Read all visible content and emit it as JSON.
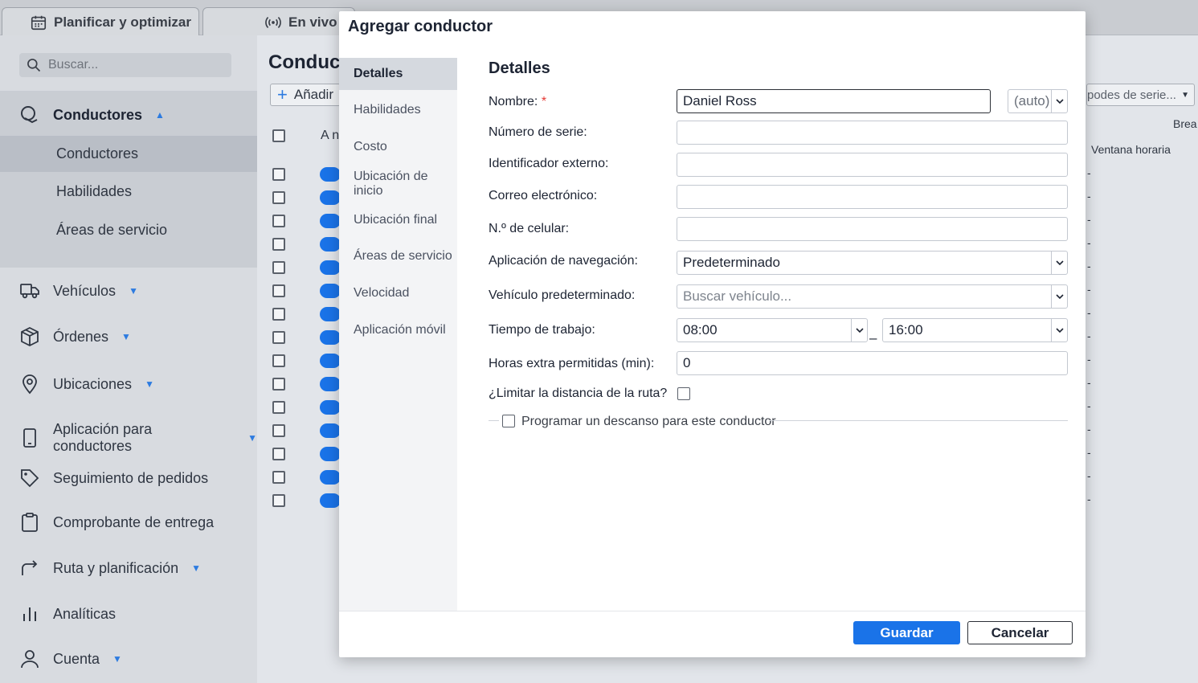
{
  "tabs": [
    {
      "label": "Planificar y optimizar",
      "icon": "calendar-icon"
    },
    {
      "label": "En vivo",
      "icon": "broadcast-icon"
    }
  ],
  "sidebar": {
    "search_placeholder": "Buscar...",
    "items": [
      {
        "label": "Conductores",
        "icon": "steering-wheel-icon",
        "expanded": true
      },
      {
        "label": "Vehículos",
        "icon": "truck-icon"
      },
      {
        "label": "Órdenes",
        "icon": "package-icon"
      },
      {
        "label": "Ubicaciones",
        "icon": "map-pin-icon"
      },
      {
        "label": "Aplicación para conductores",
        "icon": "phone-icon"
      },
      {
        "label": "Seguimiento de pedidos",
        "icon": "tag-icon"
      },
      {
        "label": "Comprobante de entrega",
        "icon": "clipboard-icon"
      },
      {
        "label": "Ruta y planificación",
        "icon": "route-arrow-icon"
      },
      {
        "label": "Analíticas",
        "icon": "bar-chart-icon"
      },
      {
        "label": "Cuenta",
        "icon": "user-icon"
      }
    ],
    "subitems": [
      "Conductores",
      "Habilidades",
      "Áreas de servicio"
    ],
    "active_subitem": "Conductores"
  },
  "background": {
    "title": "Conduct",
    "add_label": "Añadir",
    "col_a": "A n",
    "right_select": "podes de serie...",
    "right_brea": "Brea",
    "right_header": "Ventana horaria",
    "row_dash": "-"
  },
  "modal": {
    "title": "Agregar conductor",
    "nav": [
      "Detalles",
      "Habilidades",
      "Costo",
      "Ubicación de inicio",
      "Ubicación final",
      "Áreas de servicio",
      "Velocidad",
      "Aplicación móvil"
    ],
    "active_nav": "Detalles",
    "section_title": "Detalles",
    "fields": {
      "name_label": "Nombre:",
      "name_required": "*",
      "name_value": "Daniel Ross",
      "name_auto": "(auto)",
      "serial_label": "Número de serie:",
      "serial_value": "",
      "external_id_label": "Identificador externo:",
      "external_id_value": "",
      "email_label": "Correo electrónico:",
      "email_value": "",
      "phone_label": "N.º de celular:",
      "phone_value": "",
      "nav_app_label": "Aplicación de navegación:",
      "nav_app_value": "Predeterminado",
      "default_vehicle_label": "Vehículo predeterminado:",
      "default_vehicle_placeholder": "Buscar vehículo...",
      "work_time_label": "Tiempo de trabajo:",
      "work_time_start": "08:00",
      "work_time_separator": "–",
      "work_time_end": "16:00",
      "overtime_label": "Horas extra permitidas (min):",
      "overtime_value": "0",
      "limit_distance_label": "¿Limitar la distancia de la ruta?",
      "limit_distance_checked": false,
      "schedule_break_label": "Programar un descanso para este conductor",
      "schedule_break_checked": false
    },
    "save_label": "Guardar",
    "cancel_label": "Cancelar"
  },
  "colors": {
    "accent": "#1a73e8",
    "required": "#e53935"
  }
}
